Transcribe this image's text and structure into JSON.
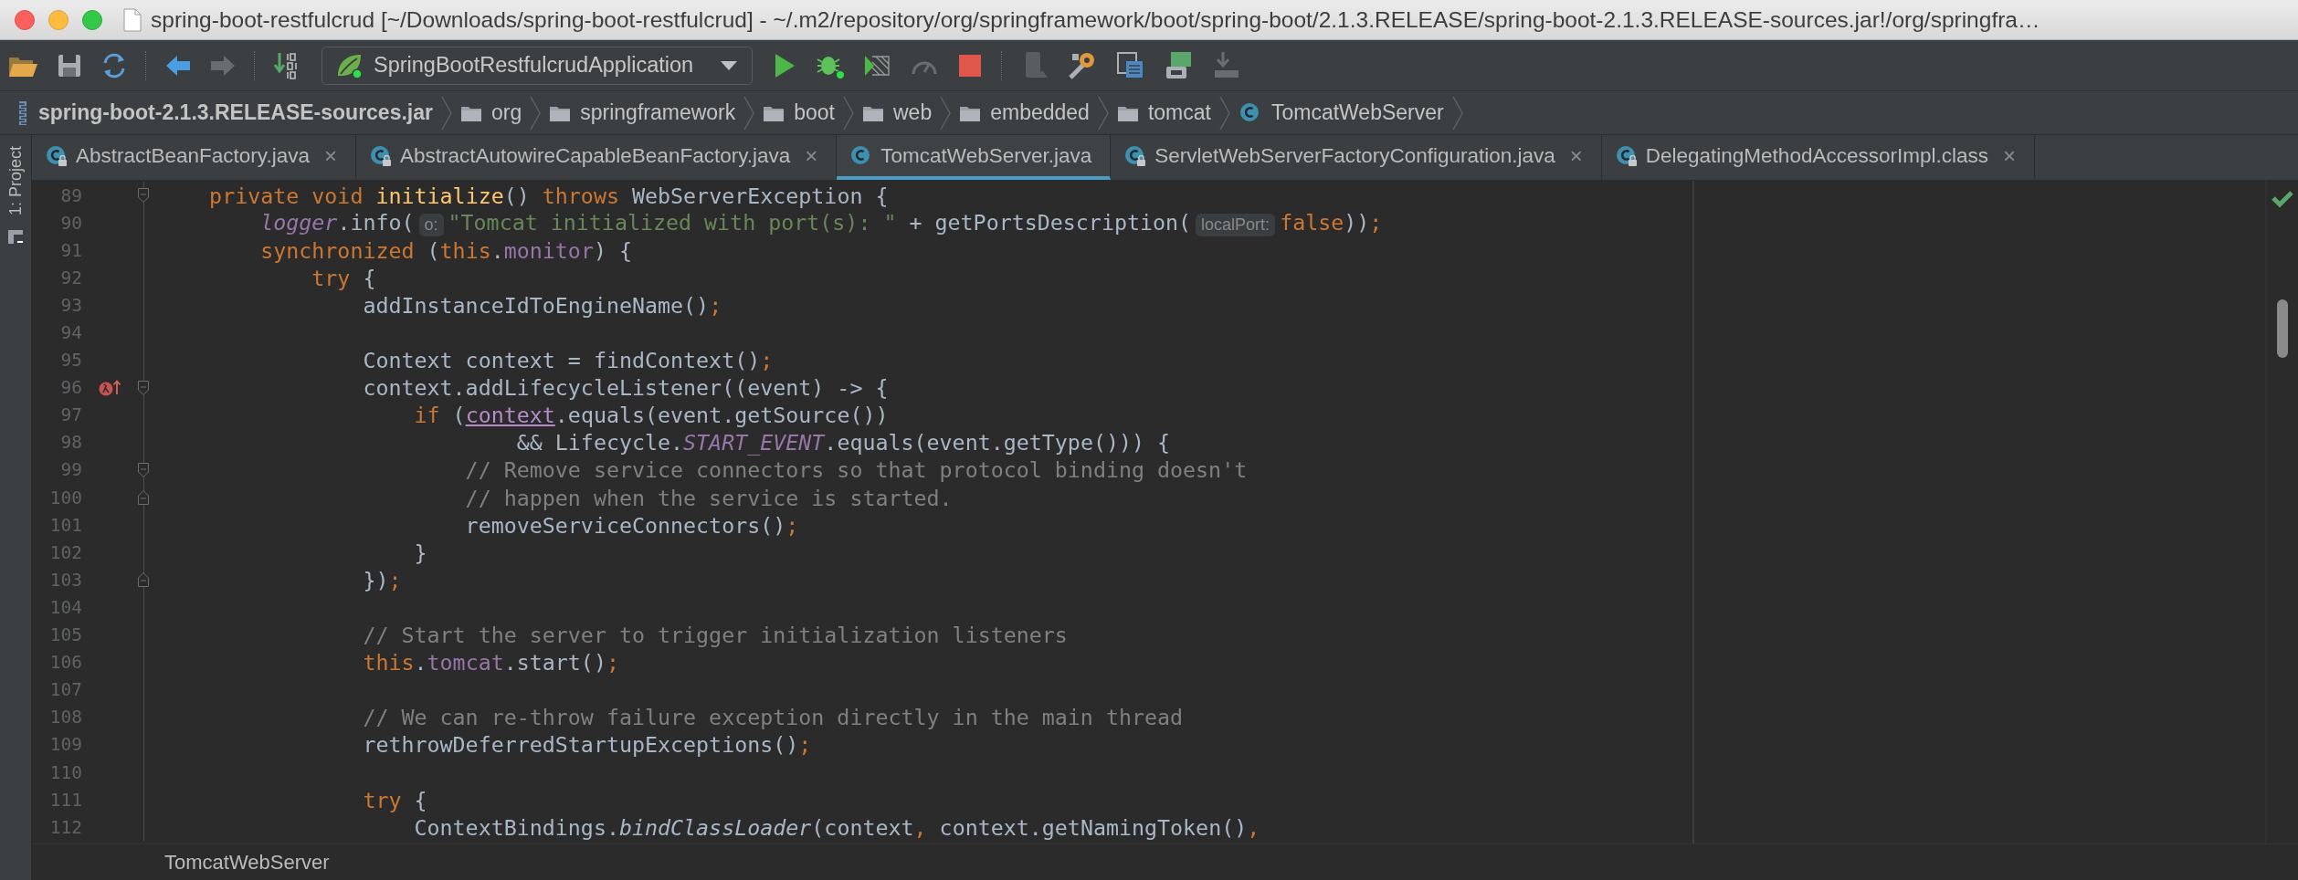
{
  "window": {
    "title": "spring-boot-restfulcrud [~/Downloads/spring-boot-restfulcrud] - ~/.m2/repository/org/springframework/boot/spring-boot/2.1.3.RELEASE/spring-boot-2.1.3.RELEASE-sources.jar!/org/springfra…"
  },
  "toolbar": {
    "run_configuration": "SpringBootRestfulcrudApplication"
  },
  "breadcrumb": [
    {
      "kind": "jar",
      "label": "spring-boot-2.1.3.RELEASE-sources.jar"
    },
    {
      "kind": "folder",
      "label": "org"
    },
    {
      "kind": "folder",
      "label": "springframework"
    },
    {
      "kind": "folder",
      "label": "boot"
    },
    {
      "kind": "folder",
      "label": "web"
    },
    {
      "kind": "folder",
      "label": "embedded"
    },
    {
      "kind": "folder",
      "label": "tomcat"
    },
    {
      "kind": "class",
      "label": "TomcatWebServer"
    }
  ],
  "project_panel": {
    "label": "1: Project"
  },
  "tabs": [
    {
      "label": "AbstractBeanFactory.java",
      "selected": false,
      "locked": true,
      "close": "×"
    },
    {
      "label": "AbstractAutowireCapableBeanFactory.java",
      "selected": false,
      "locked": true,
      "close": "×"
    },
    {
      "label": "TomcatWebServer.java",
      "selected": true,
      "locked": false
    },
    {
      "label": "ServletWebServerFactoryConfiguration.java",
      "selected": false,
      "locked": true,
      "close": "×"
    },
    {
      "label": "DelegatingMethodAccessorImpl.class",
      "selected": false,
      "locked": true,
      "close": "×"
    }
  ],
  "editor": {
    "lines": [
      {
        "number": "89",
        "fold_start": true,
        "tokens": [
          {
            "kind": "kw",
            "text": "    private void "
          },
          {
            "kind": "method_decl",
            "text": "initialize"
          },
          {
            "kind": "plain",
            "text": "() "
          },
          {
            "kind": "kw",
            "text": "throws "
          },
          {
            "kind": "plain",
            "text": "WebServerException {"
          }
        ]
      },
      {
        "number": "90",
        "tokens": [
          {
            "kind": "static_field",
            "text": "        logger"
          },
          {
            "kind": "plain",
            "text": ".info("
          },
          {
            "kind": "hint",
            "text": "o:"
          },
          {
            "kind": "string",
            "text": "\"Tomcat initialized with port(s): \""
          },
          {
            "kind": "plain",
            "text": " + getPortsDescription("
          },
          {
            "kind": "hint",
            "text": "localPort:"
          },
          {
            "kind": "kw",
            "text": "false"
          },
          {
            "kind": "plain",
            "text": "))"
          },
          {
            "kind": "punct",
            "text": ";"
          }
        ]
      },
      {
        "number": "91",
        "tokens": [
          {
            "kind": "kw",
            "text": "        synchronized"
          },
          {
            "kind": "plain",
            "text": " ("
          },
          {
            "kind": "kw",
            "text": "this"
          },
          {
            "kind": "plain",
            "text": "."
          },
          {
            "kind": "field",
            "text": "monitor"
          },
          {
            "kind": "plain",
            "text": ") {"
          }
        ]
      },
      {
        "number": "92",
        "tokens": [
          {
            "kind": "kw",
            "text": "            try"
          },
          {
            "kind": "plain",
            "text": " {"
          }
        ]
      },
      {
        "number": "93",
        "tokens": [
          {
            "kind": "plain",
            "text": "                addInstanceIdToEngineName()"
          },
          {
            "kind": "punct",
            "text": ";"
          }
        ]
      },
      {
        "number": "94"
      },
      {
        "number": "95",
        "tokens": [
          {
            "kind": "plain",
            "text": "                Context context = findContext()"
          },
          {
            "kind": "punct",
            "text": ";"
          }
        ]
      },
      {
        "number": "96",
        "lambda_marker": true,
        "fold_start": true,
        "tokens": [
          {
            "kind": "plain",
            "text": "                context.addLifecycleListener((event) -> {"
          }
        ]
      },
      {
        "number": "97",
        "tokens": [
          {
            "kind": "kw",
            "text": "                    if"
          },
          {
            "kind": "plain",
            "text": " ("
          },
          {
            "kind": "captured",
            "text": "context"
          },
          {
            "kind": "plain",
            "text": ".equals(event.getSource())"
          }
        ]
      },
      {
        "number": "98",
        "tokens": [
          {
            "kind": "plain",
            "text": "                            && Lifecycle."
          },
          {
            "kind": "static_field",
            "text": "START_EVENT"
          },
          {
            "kind": "plain",
            "text": ".equals(event.getType())) {"
          }
        ]
      },
      {
        "number": "99",
        "fold_start": true,
        "tokens": [
          {
            "kind": "comment",
            "text": "                        // Remove service connectors so that protocol binding doesn't"
          }
        ]
      },
      {
        "number": "100",
        "fold_end": true,
        "tokens": [
          {
            "kind": "comment",
            "text": "                        // happen when the service is started."
          }
        ]
      },
      {
        "number": "101",
        "tokens": [
          {
            "kind": "plain",
            "text": "                        removeServiceConnectors()"
          },
          {
            "kind": "punct",
            "text": ";"
          }
        ]
      },
      {
        "number": "102",
        "tokens": [
          {
            "kind": "plain",
            "text": "                    }"
          }
        ]
      },
      {
        "number": "103",
        "fold_end": true,
        "tokens": [
          {
            "kind": "plain",
            "text": "                })"
          },
          {
            "kind": "punct",
            "text": ";"
          }
        ]
      },
      {
        "number": "104"
      },
      {
        "number": "105",
        "tokens": [
          {
            "kind": "comment",
            "text": "                // Start the server to trigger initialization listeners"
          }
        ]
      },
      {
        "number": "106",
        "tokens": [
          {
            "kind": "kw",
            "text": "                this"
          },
          {
            "kind": "plain",
            "text": "."
          },
          {
            "kind": "field",
            "text": "tomcat"
          },
          {
            "kind": "plain",
            "text": ".start()"
          },
          {
            "kind": "punct",
            "text": ";"
          }
        ]
      },
      {
        "number": "107"
      },
      {
        "number": "108",
        "tokens": [
          {
            "kind": "comment",
            "text": "                // We can re-throw failure exception directly in the main thread"
          }
        ]
      },
      {
        "number": "109",
        "tokens": [
          {
            "kind": "plain",
            "text": "                rethrowDeferredStartupExceptions()"
          },
          {
            "kind": "punct",
            "text": ";"
          }
        ]
      },
      {
        "number": "110"
      },
      {
        "number": "111",
        "tokens": [
          {
            "kind": "kw",
            "text": "                try"
          },
          {
            "kind": "plain",
            "text": " {"
          }
        ]
      },
      {
        "number": "112",
        "tokens": [
          {
            "kind": "plain",
            "text": "                    ContextBindings."
          },
          {
            "kind": "static_method",
            "text": "bindClassLoader"
          },
          {
            "kind": "plain",
            "text": "(context"
          },
          {
            "kind": "punct",
            "text": ","
          },
          {
            "kind": "plain",
            "text": " context.getNamingToken()"
          },
          {
            "kind": "punct",
            "text": ","
          }
        ]
      }
    ]
  },
  "status_bar": {
    "breadcrumb": "TomcatWebServer"
  }
}
